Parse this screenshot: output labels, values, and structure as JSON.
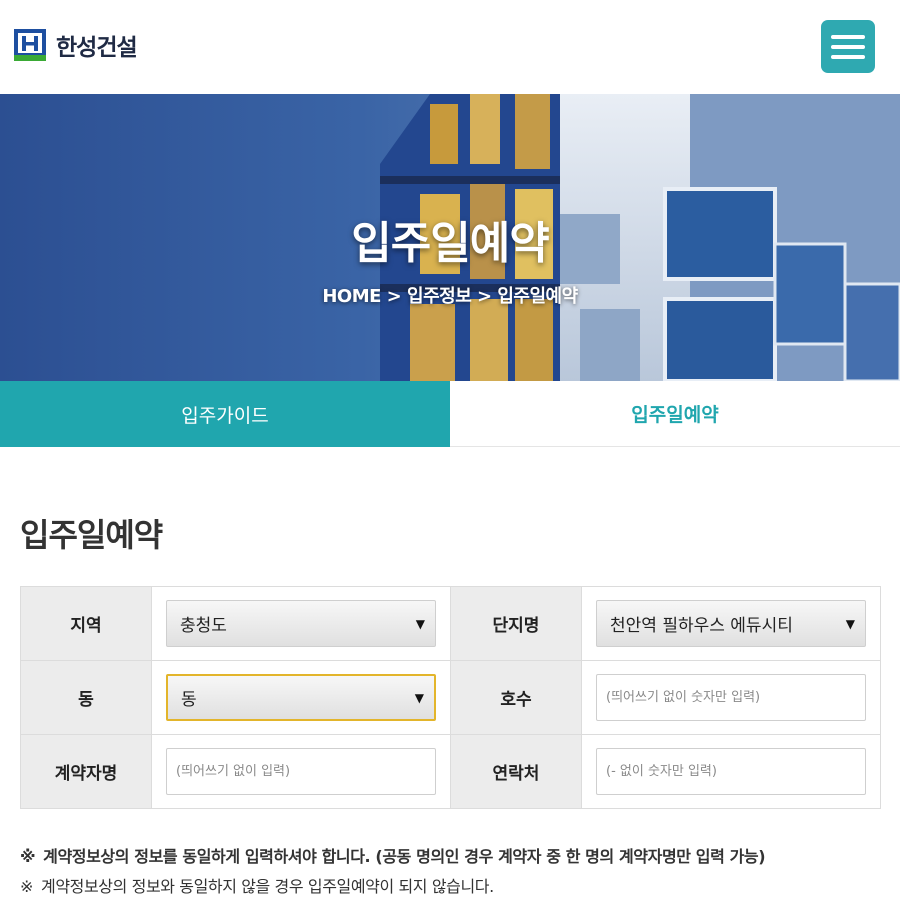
{
  "brand": {
    "name": "한성건설",
    "logo_letter": "H"
  },
  "header": {
    "menu_icon": "hamburger-menu-icon"
  },
  "hero": {
    "title": "입주일예약",
    "breadcrumb": "HOME > 입주정보 > 입주일예약"
  },
  "tabs": [
    {
      "label": "입주가이드",
      "active": false
    },
    {
      "label": "입주일예약",
      "active": true
    }
  ],
  "section": {
    "title": "입주일예약"
  },
  "form": {
    "region": {
      "label": "지역",
      "value": "충청도"
    },
    "complex": {
      "label": "단지명",
      "value": "천안역 필하우스 에듀시티"
    },
    "building": {
      "label": "동",
      "value": "동"
    },
    "unit": {
      "label": "호수",
      "placeholder": "(띄어쓰기 없이 숫자만 입력)"
    },
    "contractor": {
      "label": "계약자명",
      "placeholder": "(띄어쓰기 없이 입력)"
    },
    "phone": {
      "label": "연락처",
      "placeholder": "(- 없이 숫자만 입력)"
    }
  },
  "notes": [
    {
      "mark": "※",
      "text": "계약정보상의 정보를 동일하게 입력하셔야 합니다. (공동 명의인 경우 계약자 중 한 명의 계약자명만 입력 가능)"
    },
    {
      "mark": "※",
      "text": "계약정보상의 정보와 동일하지 않을 경우 입주일예약이 되지 않습니다."
    }
  ],
  "colors": {
    "accent": "#20a6ae",
    "menu": "#2fa9b1",
    "focus": "#e3b52b",
    "logo_blue": "#1e4fa0",
    "logo_green": "#3aaa35"
  }
}
